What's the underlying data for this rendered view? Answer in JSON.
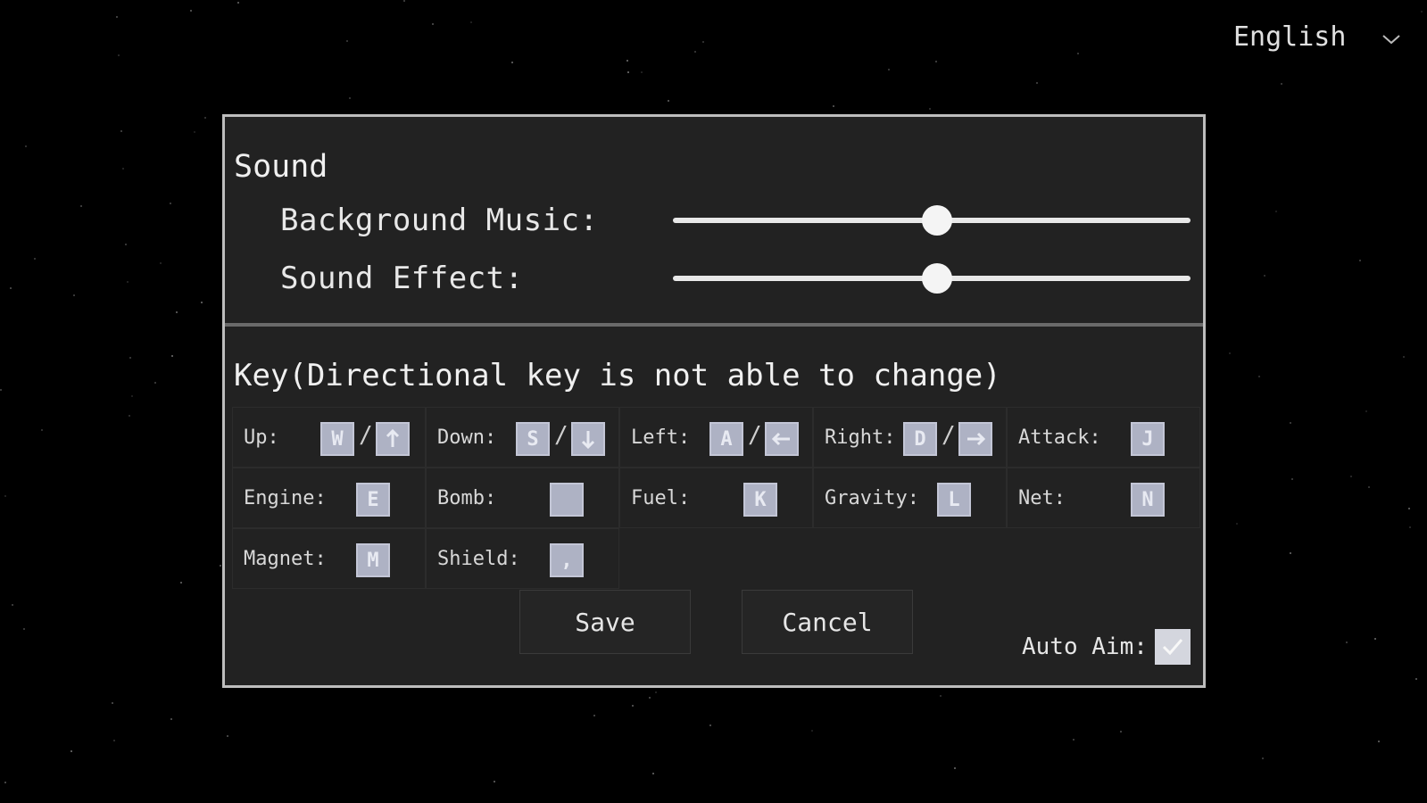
{
  "language": {
    "selected": "English"
  },
  "sound": {
    "title": "Sound",
    "background_music": {
      "label": "Background Music:",
      "value": 0.51
    },
    "sound_effect": {
      "label": "Sound Effect:",
      "value": 0.51
    }
  },
  "keys": {
    "title": "Key(Directional key is not able to change)",
    "up": {
      "label": "Up:",
      "key": "W"
    },
    "down": {
      "label": "Down:",
      "key": "S"
    },
    "left": {
      "label": "Left:",
      "key": "A"
    },
    "right": {
      "label": "Right:",
      "key": "D"
    },
    "attack": {
      "label": "Attack:",
      "key": "J"
    },
    "engine": {
      "label": "Engine:",
      "key": "E"
    },
    "bomb": {
      "label": "Bomb:",
      "key": ""
    },
    "fuel": {
      "label": "Fuel:",
      "key": "K"
    },
    "gravity": {
      "label": "Gravity:",
      "key": "L"
    },
    "net": {
      "label": "Net:",
      "key": "N"
    },
    "magnet": {
      "label": "Magnet:",
      "key": "M"
    },
    "shield": {
      "label": "Shield:",
      "key": ","
    },
    "separator": "/"
  },
  "buttons": {
    "save": "Save",
    "cancel": "Cancel"
  },
  "auto_aim": {
    "label": "Auto Aim:",
    "checked": true
  },
  "colors": {
    "background": "#000000",
    "panel": "#222222",
    "panel_border": "#bdbdbd",
    "keycap": "#aeb2c4",
    "text": "#e8e8e8"
  }
}
